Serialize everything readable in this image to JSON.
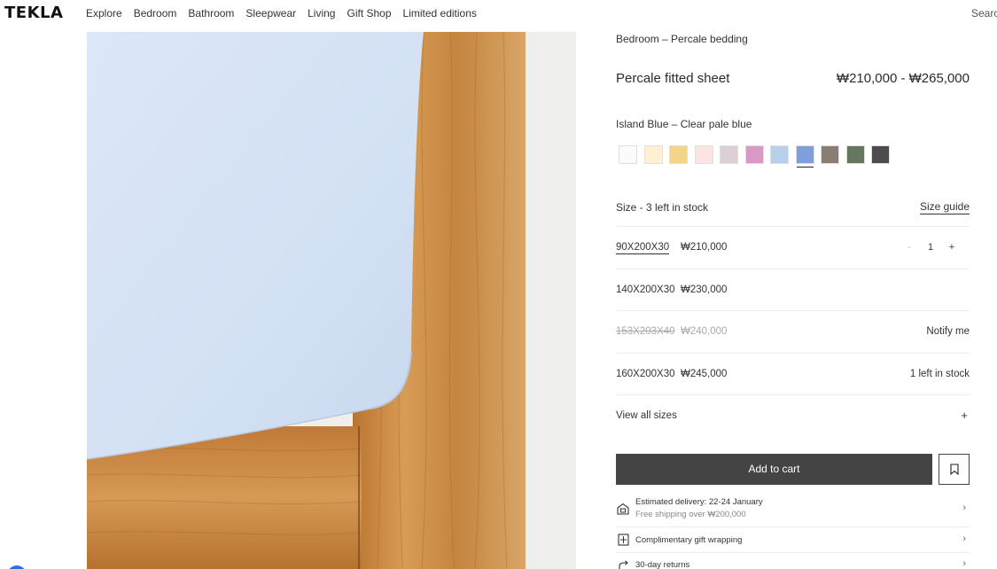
{
  "header": {
    "logo": "TEKLA",
    "nav": [
      "Explore",
      "Bedroom",
      "Bathroom",
      "Sleepwear",
      "Living",
      "Gift Shop",
      "Limited editions"
    ],
    "search_label": "Search"
  },
  "product": {
    "breadcrumb": "Bedroom – Percale bedding",
    "title": "Percale fitted sheet",
    "price_range": "₩210,000 - ₩265,000",
    "color_name": "Island Blue – Clear pale blue",
    "swatches": [
      {
        "color": "#fbfbfb",
        "selected": false
      },
      {
        "color": "#fdf1d2",
        "selected": false
      },
      {
        "color": "#f2d48a",
        "selected": false
      },
      {
        "color": "#fbe4e1",
        "selected": false
      },
      {
        "color": "#ddcfd6",
        "selected": false
      },
      {
        "color": "#d899c4",
        "selected": false
      },
      {
        "color": "#b8d0ea",
        "selected": false
      },
      {
        "color": "#7f9fdc",
        "selected": true
      },
      {
        "color": "#8a7e73",
        "selected": false
      },
      {
        "color": "#66775f",
        "selected": false
      },
      {
        "color": "#4c4c4c",
        "selected": false
      }
    ],
    "size_heading": "Size - 3 left in stock",
    "size_guide": "Size guide",
    "sizes": [
      {
        "size": "90X200X30",
        "price": "₩210,000",
        "right": "",
        "quantity": "1",
        "minus": "-",
        "plus": "+"
      },
      {
        "size": "140X200X30",
        "price": "₩230,000",
        "right": ""
      },
      {
        "size": "153X203X40",
        "price": "₩240,000",
        "right": "Notify me"
      },
      {
        "size": "160X200X30",
        "price": "₩245,000",
        "right": "1 left in stock"
      }
    ],
    "view_all": "View all sizes",
    "view_all_icon": "+",
    "add_to_cart": "Add to cart",
    "info": [
      {
        "icon": "delivery-icon",
        "line1": "Estimated delivery: 22-24 January",
        "line2": "Free shipping over ₩200,000"
      },
      {
        "icon": "gift-icon",
        "line1": "Complimentary gift wrapping",
        "line2": ""
      },
      {
        "icon": "return-icon",
        "line1": "30-day returns",
        "line2": ""
      }
    ],
    "chevron": "›"
  },
  "colors": {
    "accent_button": "#444444",
    "sheet": "#dce8f7",
    "wood": "#c98b45"
  }
}
